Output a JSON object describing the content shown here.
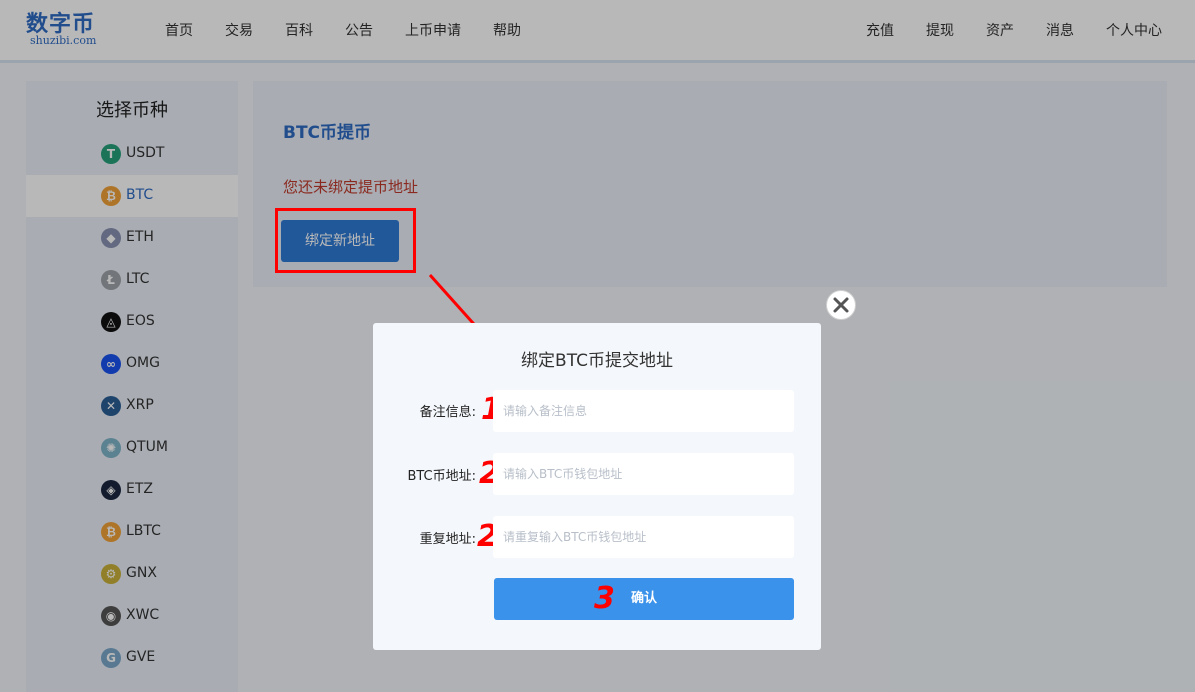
{
  "header": {
    "logo_text": "数字币",
    "logo_sub": "shuzibi.com",
    "nav_left": [
      "首页",
      "交易",
      "百科",
      "公告",
      "上币申请",
      "帮助"
    ],
    "nav_right": [
      "充值",
      "提现",
      "资产",
      "消息",
      "个人中心"
    ]
  },
  "sidebar": {
    "title": "选择币种",
    "coins": [
      {
        "label": "USDT",
        "icon": "usdt-icon",
        "color": "#26a17b",
        "glyph": "T"
      },
      {
        "label": "BTC",
        "icon": "btc-icon",
        "color": "#f2a33a",
        "glyph": "₿",
        "active": true
      },
      {
        "label": "ETH",
        "icon": "eth-icon",
        "color": "#8a92b2",
        "glyph": "◆"
      },
      {
        "label": "LTC",
        "icon": "ltc-icon",
        "color": "#9ea3a8",
        "glyph": "Ł"
      },
      {
        "label": "EOS",
        "icon": "eos-icon",
        "color": "#111111",
        "glyph": "◬"
      },
      {
        "label": "OMG",
        "icon": "omg-icon",
        "color": "#1a53f0",
        "glyph": "∞"
      },
      {
        "label": "XRP",
        "icon": "xrp-icon",
        "color": "#2b5f96",
        "glyph": "✕"
      },
      {
        "label": "QTUM",
        "icon": "qtum-icon",
        "color": "#7fb5c9",
        "glyph": "✺"
      },
      {
        "label": "ETZ",
        "icon": "etz-icon",
        "color": "#1a2740",
        "glyph": "◈"
      },
      {
        "label": "LBTC",
        "icon": "lbtc-icon",
        "color": "#f2a33a",
        "glyph": "₿"
      },
      {
        "label": "GNX",
        "icon": "gnx-icon",
        "color": "#c9b23a",
        "glyph": "⚙"
      },
      {
        "label": "XWC",
        "icon": "xwc-icon",
        "color": "#555555",
        "glyph": "◉"
      },
      {
        "label": "GVE",
        "icon": "gve-icon",
        "color": "#7aa8c9",
        "glyph": "G"
      }
    ]
  },
  "panel": {
    "title": "BTC币提币",
    "warning": "您还未绑定提币地址",
    "bind_button": "绑定新地址"
  },
  "dialog": {
    "title": "绑定BTC币提交地址",
    "fields": [
      {
        "label": "备注信息:",
        "placeholder": "请输入备注信息",
        "step": "1"
      },
      {
        "label": "BTC币地址:",
        "placeholder": "请输入BTC币钱包地址",
        "step": "2"
      },
      {
        "label": "重复地址:",
        "placeholder": "请重复输入BTC币钱包地址",
        "step": "2"
      }
    ],
    "confirm_label": "确认",
    "confirm_step": "3"
  },
  "colors": {
    "accent": "#2e6bc4",
    "button": "#2f7ad6",
    "confirm": "#3a92ea",
    "warning": "#c0392b",
    "annotation": "#ff0000"
  }
}
